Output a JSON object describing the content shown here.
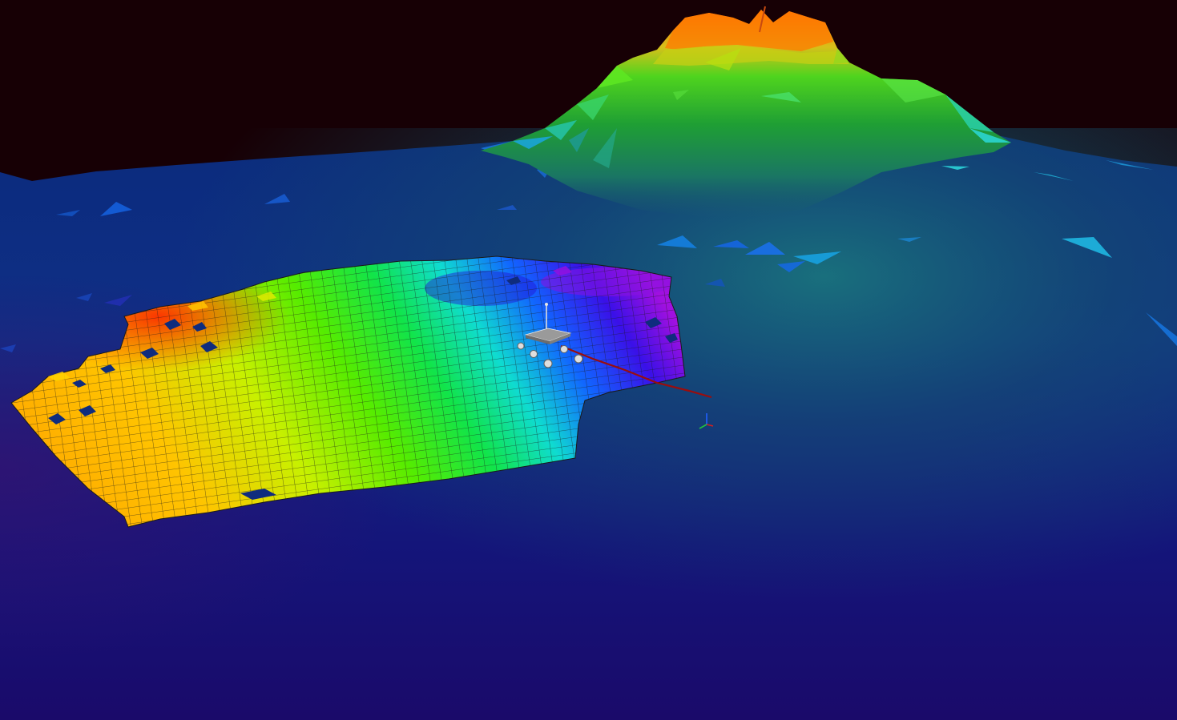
{
  "viewer": {
    "view_type": "3d-terrain-view",
    "colormap": "rainbow-elevation",
    "colors": {
      "sky": "#170005",
      "terrain_low": "#120a6a",
      "terrain_mid": "#0e3f78",
      "mesh_low": "#1a0a9a",
      "mesh_high": "#ff3a00",
      "mountain_peak": "#ff7a00",
      "mountain_mid": "#27c11f",
      "trajectory": "#9a0d0d"
    }
  },
  "scene": {
    "objects": [
      {
        "name": "background-terrain",
        "type": "terrain"
      },
      {
        "name": "mountain",
        "type": "terrain-feature"
      },
      {
        "name": "elevation-mesh-patch",
        "type": "mesh"
      },
      {
        "name": "rover",
        "type": "robot"
      },
      {
        "name": "trajectory-path",
        "type": "path"
      },
      {
        "name": "axis-gizmo",
        "type": "gizmo"
      }
    ]
  }
}
